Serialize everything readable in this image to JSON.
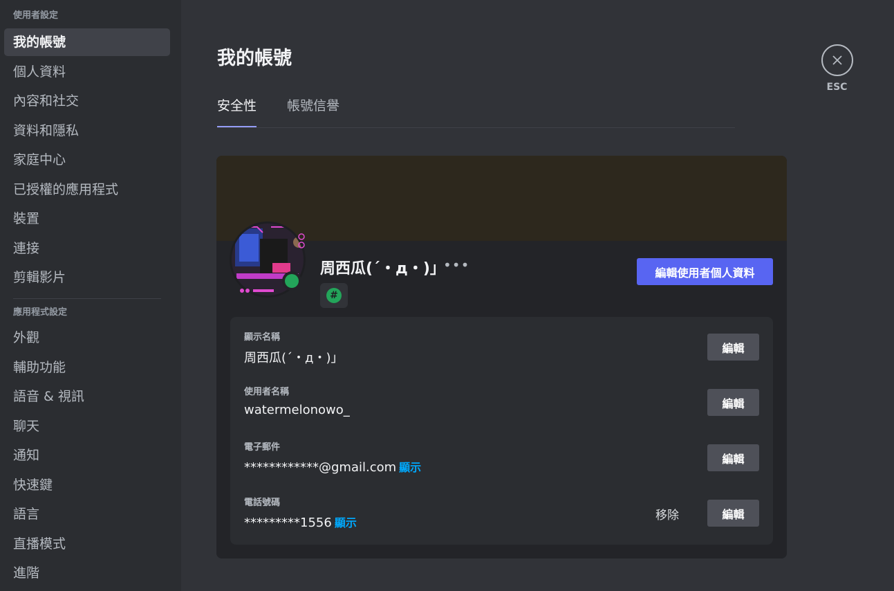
{
  "sidebar": {
    "user_settings_header": "使用者設定",
    "user_items": [
      {
        "label": "我的帳號"
      },
      {
        "label": "個人資料"
      },
      {
        "label": "內容和社交"
      },
      {
        "label": "資料和隱私"
      },
      {
        "label": "家庭中心"
      },
      {
        "label": "已授權的應用程式"
      },
      {
        "label": "裝置"
      },
      {
        "label": "連接"
      },
      {
        "label": "剪輯影片"
      }
    ],
    "app_settings_header": "應用程式設定",
    "app_items": [
      {
        "label": "外觀"
      },
      {
        "label": "輔助功能"
      },
      {
        "label": "語音 & 視訊"
      },
      {
        "label": "聊天"
      },
      {
        "label": "通知"
      },
      {
        "label": "快速鍵"
      },
      {
        "label": "語言"
      },
      {
        "label": "直播模式"
      },
      {
        "label": "進階"
      }
    ]
  },
  "page": {
    "title": "我的帳號",
    "tabs": [
      {
        "label": "安全性"
      },
      {
        "label": "帳號信譽"
      }
    ],
    "esc_label": "ESC"
  },
  "profile": {
    "display_name": "周西瓜(ˊ・д・)」",
    "more": "•••",
    "badge_symbol": "#",
    "edit_profile_label": "編輯使用者個人資料",
    "banner_color": "#2d281d",
    "status_color": "#23a55a"
  },
  "fields": {
    "display_name": {
      "label": "顯示名稱",
      "value": "周西瓜(ˊ・д・)」",
      "edit": "編輯"
    },
    "username": {
      "label": "使用者名稱",
      "value": "watermelonowo_",
      "edit": "編輯"
    },
    "email": {
      "label": "電子郵件",
      "value": "************@gmail.com",
      "reveal": "顯示",
      "edit": "編輯"
    },
    "phone": {
      "label": "電話號碼",
      "value": "*********1556",
      "reveal": "顯示",
      "remove": "移除",
      "edit": "編輯"
    }
  },
  "colors": {
    "accent": "#5865f2",
    "link": "#00a8fc",
    "tab_underline": "#949cf7"
  }
}
